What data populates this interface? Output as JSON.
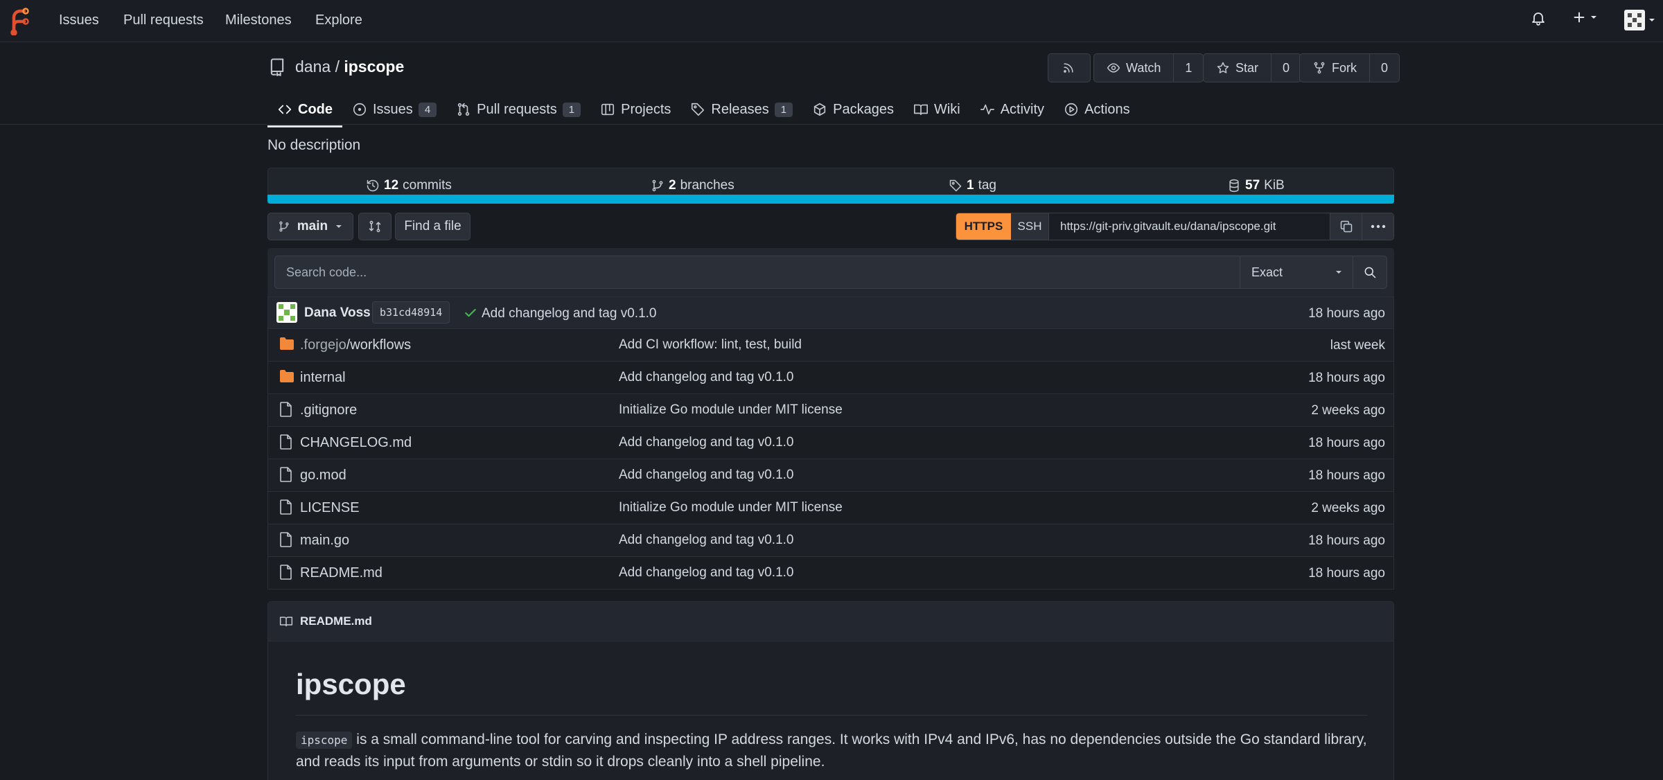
{
  "topnav": {
    "items": [
      "Issues",
      "Pull requests",
      "Milestones",
      "Explore"
    ]
  },
  "repo": {
    "owner": "dana",
    "separator": "/",
    "name": "ipscope",
    "description": "No description"
  },
  "actions": {
    "watch_label": "Watch",
    "watch_count": "1",
    "star_label": "Star",
    "star_count": "0",
    "fork_label": "Fork",
    "fork_count": "0"
  },
  "tabs": [
    {
      "label": "Code"
    },
    {
      "label": "Issues",
      "badge": "4"
    },
    {
      "label": "Pull requests",
      "badge": "1"
    },
    {
      "label": "Projects"
    },
    {
      "label": "Releases",
      "badge": "1"
    },
    {
      "label": "Packages"
    },
    {
      "label": "Wiki"
    },
    {
      "label": "Activity"
    },
    {
      "label": "Actions"
    }
  ],
  "stats": {
    "commits_num": "12",
    "commits_label": "commits",
    "branches_num": "2",
    "branches_label": "branches",
    "tags_num": "1",
    "tags_label": "tag",
    "size_num": "57",
    "size_label": "KiB"
  },
  "language_color": "#00add8",
  "toolbar": {
    "branch": "main",
    "find_file": "Find a file",
    "https": "HTTPS",
    "ssh": "SSH",
    "clone_url": "https://git-priv.gitvault.eu/dana/ipscope.git"
  },
  "search": {
    "placeholder": "Search code...",
    "mode": "Exact"
  },
  "latest_commit": {
    "author": "Dana Voss",
    "sha": "b31cd48914",
    "message": "Add changelog and tag v0.1.0",
    "age": "18 hours ago"
  },
  "files": [
    {
      "dir_prefix": ".forgejo",
      "name": "/workflows",
      "type": "folder",
      "message": "Add CI workflow: lint, test, build",
      "age": "last week"
    },
    {
      "dir_prefix": "",
      "name": "internal",
      "type": "folder",
      "message": "Add changelog and tag v0.1.0",
      "age": "18 hours ago"
    },
    {
      "dir_prefix": "",
      "name": ".gitignore",
      "type": "file",
      "message": "Initialize Go module under MIT license",
      "age": "2 weeks ago"
    },
    {
      "dir_prefix": "",
      "name": "CHANGELOG.md",
      "type": "file",
      "message": "Add changelog and tag v0.1.0",
      "age": "18 hours ago"
    },
    {
      "dir_prefix": "",
      "name": "go.mod",
      "type": "file",
      "message": "Add changelog and tag v0.1.0",
      "age": "18 hours ago"
    },
    {
      "dir_prefix": "",
      "name": "LICENSE",
      "type": "file",
      "message": "Initialize Go module under MIT license",
      "age": "2 weeks ago"
    },
    {
      "dir_prefix": "",
      "name": "main.go",
      "type": "file",
      "message": "Add changelog and tag v0.1.0",
      "age": "18 hours ago"
    },
    {
      "dir_prefix": "",
      "name": "README.md",
      "type": "file",
      "message": "Add changelog and tag v0.1.0",
      "age": "18 hours ago"
    }
  ],
  "readme": {
    "filename": "README.md",
    "heading": "ipscope",
    "code": "ipscope",
    "paragraph": " is a small command-line tool for carving and inspecting IP address ranges. It works with IPv4 and IPv6, has no dependencies outside the Go standard library, and reads its input from arguments or stdin so it drops cleanly into a shell pipeline."
  }
}
